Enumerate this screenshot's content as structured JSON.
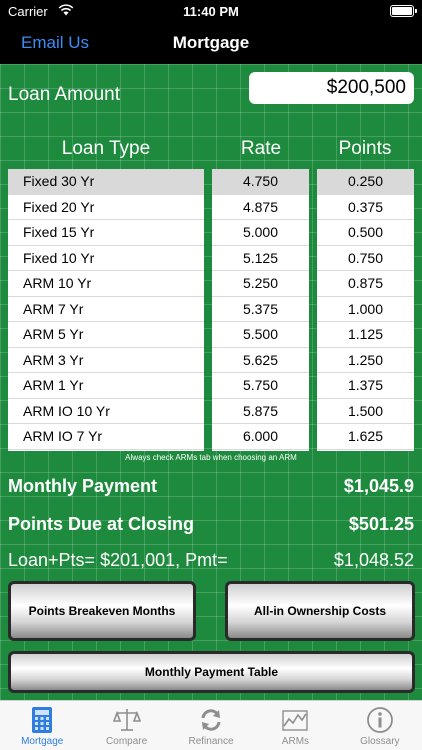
{
  "status": {
    "carrier": "Carrier",
    "time": "11:40 PM"
  },
  "nav": {
    "left_label": "Email Us",
    "title": "Mortgage"
  },
  "loan": {
    "label": "Loan Amount",
    "value": "$200,500"
  },
  "columns": {
    "type": "Loan Type",
    "rate": "Rate",
    "points": "Points"
  },
  "loans": [
    {
      "type": "Fixed 30 Yr",
      "rate": "4.750",
      "points": "0.250"
    },
    {
      "type": "Fixed 20 Yr",
      "rate": "4.875",
      "points": "0.375"
    },
    {
      "type": "Fixed 15 Yr",
      "rate": "5.000",
      "points": "0.500"
    },
    {
      "type": "Fixed 10 Yr",
      "rate": "5.125",
      "points": "0.750"
    },
    {
      "type": "ARM 10 Yr",
      "rate": "5.250",
      "points": "0.875"
    },
    {
      "type": "ARM 7 Yr",
      "rate": "5.375",
      "points": "1.000"
    },
    {
      "type": "ARM 5 Yr",
      "rate": "5.500",
      "points": "1.125"
    },
    {
      "type": "ARM 3 Yr",
      "rate": "5.625",
      "points": "1.250"
    },
    {
      "type": "ARM 1 Yr",
      "rate": "5.750",
      "points": "1.375"
    },
    {
      "type": "ARM IO 10 Yr",
      "rate": "5.875",
      "points": "1.500"
    },
    {
      "type": "ARM IO 7 Yr",
      "rate": "6.000",
      "points": "1.625"
    }
  ],
  "note": "Always check ARMs tab when choosing an ARM",
  "results": {
    "monthly_label": "Monthly Payment",
    "monthly_value": "$1,045.9",
    "points_label": "Points Due at Closing",
    "points_value": "$501.25",
    "loanpts_label": "Loan+Pts= $201,001, Pmt=",
    "loanpts_value": "$1,048.52"
  },
  "buttons": {
    "breakeven": "Points Breakeven Months",
    "ownership": "All-in Ownership Costs",
    "payment_table": "Monthly Payment Table"
  },
  "tabs": [
    {
      "label": "Mortgage",
      "icon": "calculator-icon"
    },
    {
      "label": "Compare",
      "icon": "scale-icon"
    },
    {
      "label": "Refinance",
      "icon": "refresh-icon"
    },
    {
      "label": "ARMs",
      "icon": "chart-icon"
    },
    {
      "label": "Glossary",
      "icon": "info-icon"
    }
  ],
  "colors": {
    "background": "#1d8a3d",
    "accent": "#2f7de1",
    "link": "#3a8df5"
  }
}
